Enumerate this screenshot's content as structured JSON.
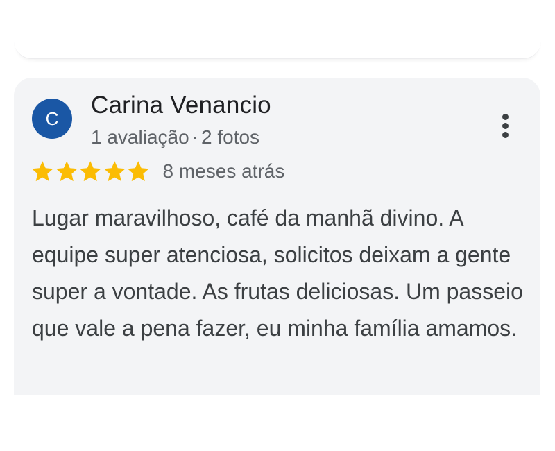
{
  "review": {
    "avatar_initial": "C",
    "reviewer_name": "Carina Venancio",
    "review_count": "1 avaliação",
    "separator": "·",
    "photo_count": "2 fotos",
    "rating": 5,
    "rating_max": 5,
    "date": "8 meses atrás",
    "text": "Lugar maravilhoso, café da manhã divino. A equipe super atenciosa, solicitos deixam a gente super a vontade. As frutas deliciosas. Um passeio que vale a pena fazer, eu minha família amamos."
  },
  "colors": {
    "avatar": "#1a57a5",
    "star": "#fbbc04",
    "card_background": "#f3f4f6"
  },
  "icons": {
    "star": "star-icon",
    "more": "more-vert-icon"
  }
}
